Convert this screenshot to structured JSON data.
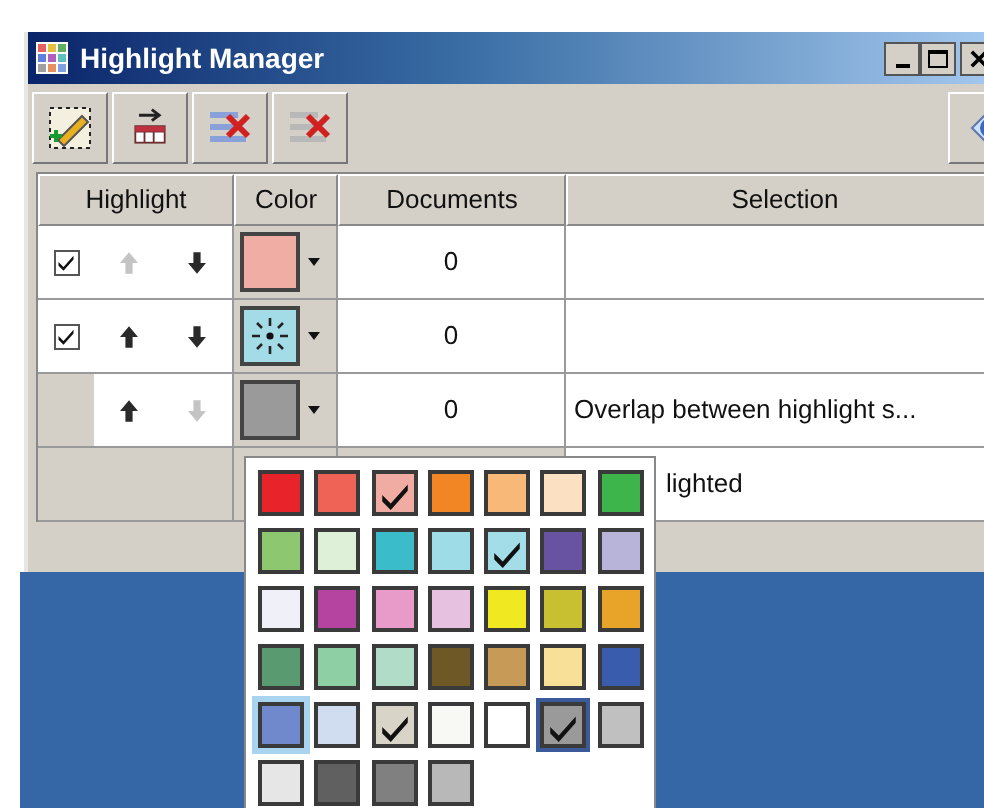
{
  "window": {
    "title": "Highlight Manager"
  },
  "table": {
    "columns": [
      "Highlight",
      "Color",
      "Documents",
      "Selection"
    ],
    "rows": [
      {
        "kind": "highlight",
        "checked": true,
        "up_disabled": true,
        "down_disabled": false,
        "patterned": false,
        "color": "#f0ada3",
        "documents": "0"
      },
      {
        "kind": "highlight",
        "checked": true,
        "up_disabled": false,
        "down_disabled": false,
        "patterned": true,
        "color": "#a3dce6",
        "documents": "0"
      },
      {
        "kind": "overlap",
        "up_disabled": false,
        "down_disabled": true,
        "patterned": false,
        "color": "#9a9a9a",
        "documents": "0",
        "selection": "Overlap between highlight s..."
      },
      {
        "kind": "unhighlighted",
        "selection": "lighted"
      }
    ]
  },
  "color_palette": {
    "swatches": [
      {
        "color": "#e8242a",
        "checked": false,
        "selected": false,
        "hovered": false
      },
      {
        "color": "#ee6355",
        "checked": false,
        "selected": false,
        "hovered": false
      },
      {
        "color": "#f0aca2",
        "checked": true,
        "selected": false,
        "hovered": false
      },
      {
        "color": "#f28524",
        "checked": false,
        "selected": false,
        "hovered": false
      },
      {
        "color": "#f8b978",
        "checked": false,
        "selected": false,
        "hovered": false
      },
      {
        "color": "#fce0c2",
        "checked": false,
        "selected": false,
        "hovered": false
      },
      {
        "color": "#3db54a",
        "checked": false,
        "selected": false,
        "hovered": false
      },
      {
        "color": "#8dc870",
        "checked": false,
        "selected": false,
        "hovered": false
      },
      {
        "color": "#dff0d8",
        "checked": false,
        "selected": false,
        "hovered": false
      },
      {
        "color": "#3bbccb",
        "checked": false,
        "selected": false,
        "hovered": false
      },
      {
        "color": "#9edde8",
        "checked": false,
        "selected": false,
        "hovered": false
      },
      {
        "color": "#a3dde8",
        "checked": true,
        "selected": false,
        "hovered": false
      },
      {
        "color": "#6853a3",
        "checked": false,
        "selected": false,
        "hovered": false
      },
      {
        "color": "#b8b3d9",
        "checked": false,
        "selected": false,
        "hovered": false
      },
      {
        "color": "#f0f0f8",
        "checked": false,
        "selected": false,
        "hovered": false
      },
      {
        "color": "#b444a0",
        "checked": false,
        "selected": false,
        "hovered": false
      },
      {
        "color": "#e89ac8",
        "checked": false,
        "selected": false,
        "hovered": false
      },
      {
        "color": "#e6c2e0",
        "checked": false,
        "selected": false,
        "hovered": false
      },
      {
        "color": "#f0e820",
        "checked": false,
        "selected": false,
        "hovered": false
      },
      {
        "color": "#c8c030",
        "checked": false,
        "selected": false,
        "hovered": false
      },
      {
        "color": "#e8a428",
        "checked": false,
        "selected": false,
        "hovered": false
      },
      {
        "color": "#5a9a70",
        "checked": false,
        "selected": false,
        "hovered": false
      },
      {
        "color": "#8ed0a4",
        "checked": false,
        "selected": false,
        "hovered": false
      },
      {
        "color": "#b0dcc8",
        "checked": false,
        "selected": false,
        "hovered": false
      },
      {
        "color": "#6e5826",
        "checked": false,
        "selected": false,
        "hovered": false
      },
      {
        "color": "#c89a58",
        "checked": false,
        "selected": false,
        "hovered": false
      },
      {
        "color": "#f8e098",
        "checked": false,
        "selected": false,
        "hovered": false
      },
      {
        "color": "#3a5cac",
        "checked": false,
        "selected": false,
        "hovered": false
      },
      {
        "color": "#7088cc",
        "checked": false,
        "selected": false,
        "hovered": true
      },
      {
        "color": "#d0dcf0",
        "checked": false,
        "selected": false,
        "hovered": false
      },
      {
        "color": "#d8d4c8",
        "checked": true,
        "selected": false,
        "hovered": false
      },
      {
        "color": "#f8f8f4",
        "checked": false,
        "selected": false,
        "hovered": false
      },
      {
        "color": "#ffffff",
        "checked": false,
        "selected": false,
        "hovered": false
      },
      {
        "color": "#9a9a9a",
        "checked": true,
        "selected": true,
        "hovered": false
      },
      {
        "color": "#c0c0c0",
        "checked": false,
        "selected": false,
        "hovered": false
      },
      {
        "color": "#e6e6e6",
        "checked": false,
        "selected": false,
        "hovered": false
      },
      {
        "color": "#606060",
        "checked": false,
        "selected": false,
        "hovered": false
      },
      {
        "color": "#808080",
        "checked": false,
        "selected": false,
        "hovered": false
      },
      {
        "color": "#b8b8b8",
        "checked": false,
        "selected": false,
        "hovered": false
      }
    ]
  }
}
